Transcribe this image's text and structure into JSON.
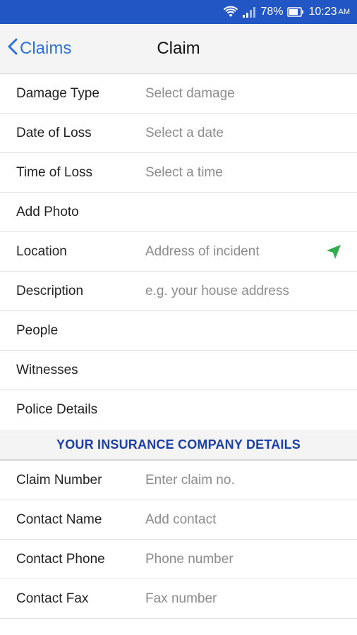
{
  "status_bar": {
    "battery_percent": "78%",
    "time": "10:23",
    "ampm": "AM"
  },
  "nav": {
    "back_label": "Claims",
    "title": "Claim"
  },
  "claim_rows": [
    {
      "label": "Damage Type",
      "value": "Select damage"
    },
    {
      "label": "Date of Loss",
      "value": "Select a date"
    },
    {
      "label": "Time of Loss",
      "value": "Select a time"
    },
    {
      "label": "Add Photo",
      "value": ""
    },
    {
      "label": "Location",
      "value": "Address of incident"
    },
    {
      "label": "Description",
      "value": "e.g. your house address"
    },
    {
      "label": "People",
      "value": ""
    },
    {
      "label": "Witnesses",
      "value": ""
    },
    {
      "label": "Police Details",
      "value": ""
    }
  ],
  "insurance_section": {
    "header": "YOUR INSURANCE COMPANY DETAILS",
    "rows": [
      {
        "label": "Claim Number",
        "value": "Enter claim no."
      },
      {
        "label": "Contact Name",
        "value": "Add contact"
      },
      {
        "label": "Contact Phone",
        "value": "Phone number"
      },
      {
        "label": "Contact Fax",
        "value": "Fax number"
      }
    ]
  },
  "colors": {
    "status_bar": "#2356c5",
    "accent_blue": "#2a72e0",
    "section_header_text": "#1d3fa8",
    "location_icon": "#2fae4e"
  },
  "icons": {
    "wifi": "wifi-icon",
    "signal": "signal-icon",
    "battery": "battery-icon",
    "back": "chevron-left-icon",
    "location": "location-arrow-icon"
  }
}
